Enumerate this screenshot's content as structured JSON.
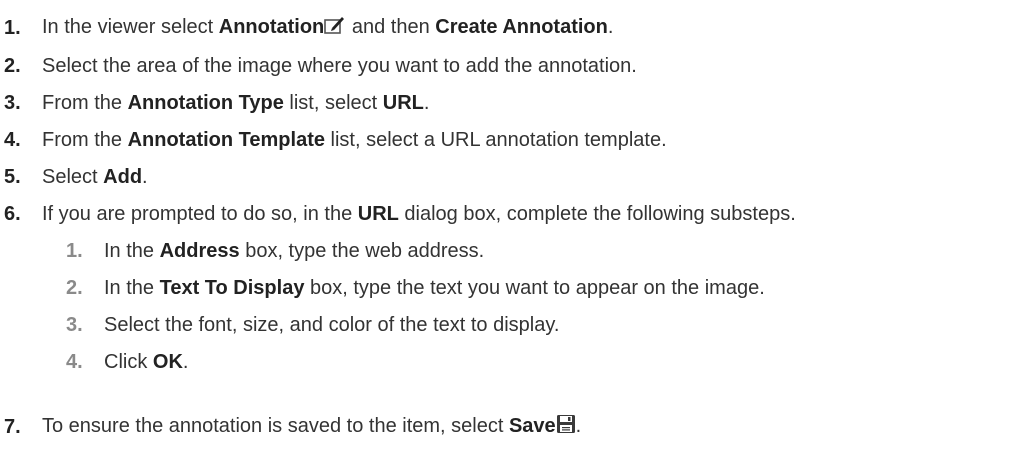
{
  "steps": [
    {
      "num": "1.",
      "parts": [
        "In the viewer select ",
        "Annotation",
        " and then ",
        "Create Annotation",
        "."
      ],
      "icon": "annotation-edit-icon"
    },
    {
      "num": "2.",
      "parts": [
        "Select the area of the image where you want to add the annotation."
      ]
    },
    {
      "num": "3.",
      "parts": [
        "From the ",
        "Annotation Type",
        " list, select ",
        "URL",
        "."
      ]
    },
    {
      "num": "4.",
      "parts": [
        "From the ",
        "Annotation Template",
        " list, select a URL annotation template."
      ]
    },
    {
      "num": "5.",
      "parts": [
        "Select ",
        "Add",
        "."
      ]
    },
    {
      "num": "6.",
      "parts": [
        "If you are prompted to do so, in the ",
        "URL",
        " dialog box, complete the following substeps."
      ]
    },
    {
      "num": "7.",
      "parts": [
        "To ensure the annotation is saved to the item, select ",
        "Save",
        "."
      ],
      "icon": "save-disk-icon"
    }
  ],
  "substeps": [
    {
      "num": "1.",
      "parts": [
        "In the ",
        "Address",
        " box, type the web address."
      ]
    },
    {
      "num": "2.",
      "parts": [
        "In the ",
        "Text To Display",
        " box, type the text you want to appear on the image."
      ]
    },
    {
      "num": "3.",
      "parts": [
        "Select the font, size, and color of the text to display."
      ]
    },
    {
      "num": "4.",
      "parts": [
        "Click ",
        "OK",
        "."
      ]
    }
  ],
  "colors": {
    "text": "#333333",
    "bold": "#222222",
    "subnum": "#8a8a8a"
  }
}
